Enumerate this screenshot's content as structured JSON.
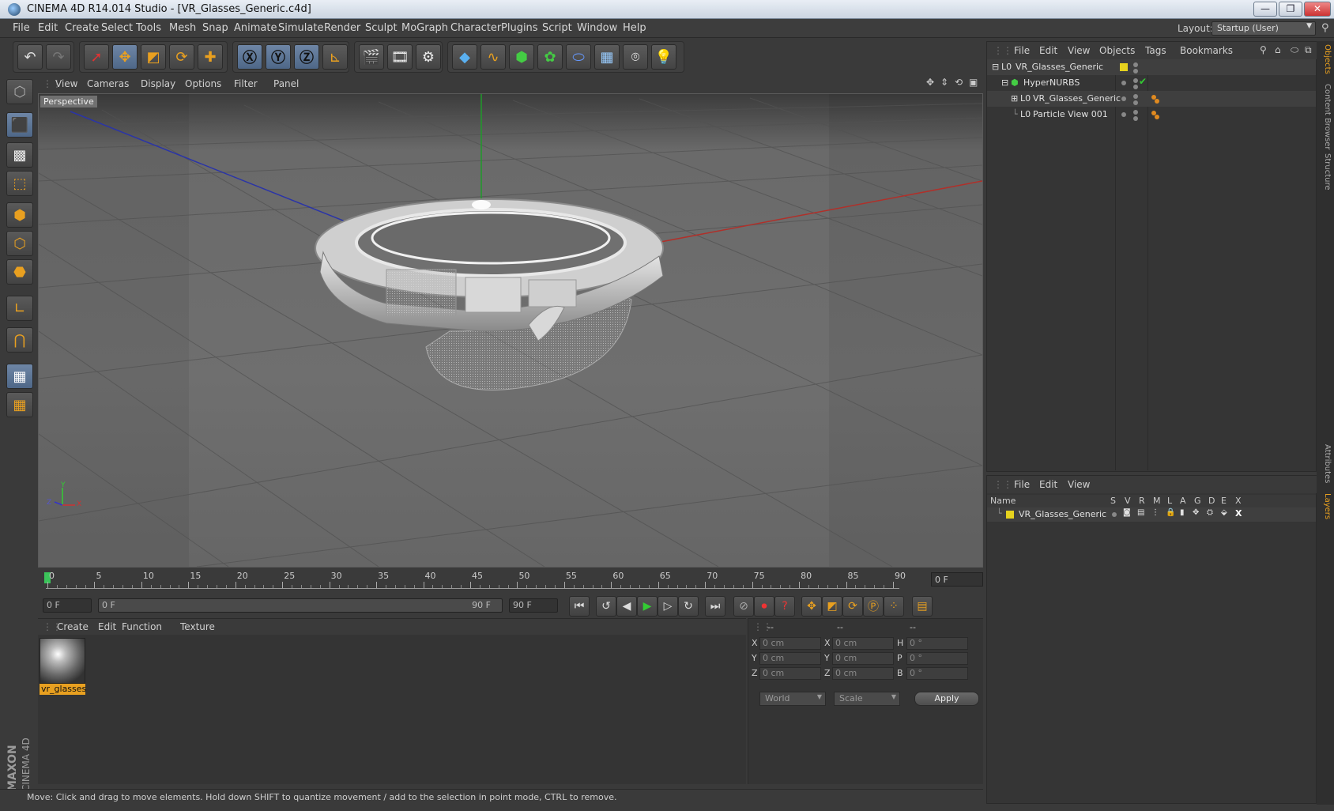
{
  "window": {
    "title": "CINEMA 4D R14.014 Studio - [VR_Glasses_Generic.c4d]",
    "minimize": "—",
    "maximize": "❐",
    "close": "✕"
  },
  "menu": [
    "File",
    "Edit",
    "Create",
    "Select",
    "Tools",
    "Mesh",
    "Snap",
    "Animate",
    "Simulate",
    "Render",
    "Sculpt",
    "MoGraph",
    "Character",
    "Plugins",
    "Script",
    "Window",
    "Help"
  ],
  "layout": {
    "label": "Layout:",
    "value": "Startup (User)"
  },
  "viewport": {
    "menu": [
      "View",
      "Cameras",
      "Display",
      "Options",
      "Filter",
      "Panel"
    ],
    "label": "Perspective",
    "axis": {
      "x": "X",
      "y": "Y",
      "z": "Z"
    }
  },
  "timeline": {
    "ticks": [
      "0",
      "5",
      "10",
      "15",
      "20",
      "25",
      "30",
      "35",
      "40",
      "45",
      "50",
      "55",
      "60",
      "65",
      "70",
      "75",
      "80",
      "85",
      "90"
    ],
    "current": "0 F",
    "start": "0 F",
    "range_start": "0 F",
    "range_end": "90 F",
    "end": "90 F"
  },
  "material": {
    "menu": [
      "Create",
      "Edit",
      "Function",
      "Texture"
    ],
    "name": "vr_glasses"
  },
  "coords": {
    "headers": [
      "--",
      "--",
      "--"
    ],
    "rows": [
      {
        "l1": "X",
        "v1": "0 cm",
        "l2": "X",
        "v2": "0 cm",
        "l3": "H",
        "v3": "0 °"
      },
      {
        "l1": "Y",
        "v1": "0 cm",
        "l2": "Y",
        "v2": "0 cm",
        "l3": "P",
        "v3": "0 °"
      },
      {
        "l1": "Z",
        "v1": "0 cm",
        "l2": "Z",
        "v2": "0 cm",
        "l3": "B",
        "v3": "0 °"
      }
    ],
    "mode": "World",
    "type": "Scale",
    "apply": "Apply"
  },
  "status": "Move: Click and drag to move elements. Hold down SHIFT to quantize movement / add to the selection in point mode, CTRL to remove.",
  "objects": {
    "menu": [
      "File",
      "Edit",
      "View",
      "Objects",
      "Tags",
      "Bookmarks"
    ],
    "items": [
      {
        "name": "VR_Glasses_Generic",
        "indent": 0,
        "icon": "L0"
      },
      {
        "name": "HyperNURBS",
        "indent": 1,
        "icon": "⬢"
      },
      {
        "name": "VR_Glasses_Generic",
        "indent": 2,
        "icon": "L0"
      },
      {
        "name": "Particle View 001",
        "indent": 2,
        "icon": "L0"
      }
    ]
  },
  "layers": {
    "menu": [
      "File",
      "Edit",
      "View"
    ],
    "columns": [
      "Name",
      "S",
      "V",
      "R",
      "M",
      "L",
      "A",
      "G",
      "D",
      "E",
      "X"
    ],
    "row": "VR_Glasses_Generic"
  },
  "side_tabs": [
    "Objects",
    "Content Browser",
    "Structure",
    "Attributes",
    "Layers"
  ],
  "branding": {
    "maxon": "MAXON",
    "cinema": "CINEMA 4D"
  },
  "colors": {
    "accent": "#e8a020",
    "layer_yellow": "#e6d21e",
    "selection_blue": "#6e86a6"
  }
}
